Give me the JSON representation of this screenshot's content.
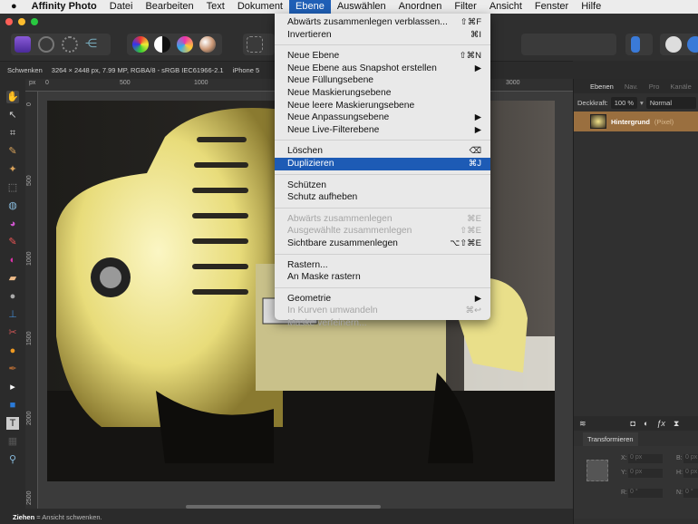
{
  "menubar": {
    "app": "Affinity Photo",
    "items": [
      "Datei",
      "Bearbeiten",
      "Text",
      "Dokument",
      "Ebene",
      "Auswählen",
      "Anordnen",
      "Filter",
      "Ansicht",
      "Fenster",
      "Hilfe"
    ],
    "active": "Ebene"
  },
  "context": {
    "tool": "Schwenken",
    "info": "3264 × 2448 px, 7.99 MP, RGBA/8 - sRGB IEC61966-2.1",
    "camera": "iPhone 5"
  },
  "ruler": {
    "unit": "px",
    "h": [
      "0",
      "500",
      "1000",
      "3000"
    ],
    "v": [
      "0",
      "500",
      "1000",
      "1500",
      "2000",
      "2500"
    ]
  },
  "menu": {
    "groups": [
      [
        {
          "label": "Abwärts zusammenlegen verblassen...",
          "shortcut": "⇧⌘F"
        },
        {
          "label": "Invertieren",
          "shortcut": "⌘I"
        }
      ],
      [
        {
          "label": "Neue Ebene",
          "shortcut": "⇧⌘N"
        },
        {
          "label": "Neue Ebene aus Snapshot erstellen",
          "shortcut": "▶"
        },
        {
          "label": "Neue Füllungsebene",
          "shortcut": ""
        },
        {
          "label": "Neue Maskierungsebene",
          "shortcut": ""
        },
        {
          "label": "Neue leere Maskierungsebene",
          "shortcut": ""
        },
        {
          "label": "Neue Anpassungsebene",
          "shortcut": "▶"
        },
        {
          "label": "Neue Live-Filterebene",
          "shortcut": "▶"
        }
      ],
      [
        {
          "label": "Löschen",
          "shortcut": "⌫"
        },
        {
          "label": "Duplizieren",
          "shortcut": "⌘J",
          "highlighted": true
        }
      ],
      [
        {
          "label": "Schützen",
          "shortcut": ""
        },
        {
          "label": "Schutz aufheben",
          "shortcut": ""
        }
      ],
      [
        {
          "label": "Abwärts zusammenlegen",
          "shortcut": "⌘E",
          "disabled": true
        },
        {
          "label": "Ausgewählte zusammenlegen",
          "shortcut": "⇧⌘E",
          "disabled": true
        },
        {
          "label": "Sichtbare zusammenlegen",
          "shortcut": "⌥⇧⌘E"
        }
      ],
      [
        {
          "label": "Rastern...",
          "shortcut": ""
        },
        {
          "label": "An Maske rastern",
          "shortcut": ""
        }
      ],
      [
        {
          "label": "Geometrie",
          "shortcut": "▶"
        },
        {
          "label": "In Kurven umwandeln",
          "shortcut": "⌘↩",
          "disabled": true
        },
        {
          "label": "Maske verfeinern...",
          "shortcut": "",
          "disabled": true
        }
      ]
    ]
  },
  "panel": {
    "tabs": [
      "Ebenen",
      "Nav.",
      "Pro",
      "Kanäle"
    ],
    "opacity_label": "Deckkraft:",
    "opacity": "100 %",
    "blend": "Normal",
    "layer_name": "Hintergrund",
    "layer_type": "(Pixel)",
    "transform": {
      "tab": "Transformieren",
      "x_label": "X:",
      "x": "0 px",
      "y_label": "Y:",
      "y": "0 px",
      "b_label": "B:",
      "b": "0 px",
      "h_label": "H:",
      "h": "0 px",
      "r_label": "R:",
      "r": "0 °",
      "n_label": "N:",
      "n": "0 °"
    }
  },
  "status": {
    "bold": "Ziehen",
    "text": " = Ansicht schwenken."
  }
}
